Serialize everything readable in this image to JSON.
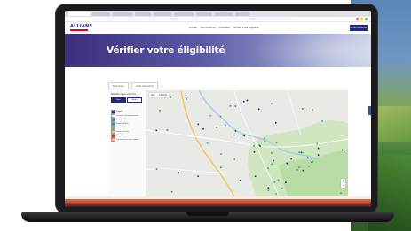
{
  "browser": {
    "tabs": [
      "",
      "",
      "",
      "",
      "",
      "",
      "",
      "",
      ""
    ],
    "active_tab": 0,
    "window_dots": [
      "#ea4335",
      "#fbbc05",
      "#34a853"
    ]
  },
  "site": {
    "logo_text": "ALLIANS",
    "nav_items": [
      "Accueil",
      "Nos solutions",
      "Actualités",
      "Vérifier votre éligibilité"
    ],
    "nav_button": "Nous contacter"
  },
  "hero": {
    "title": "Vérifier votre éligibilité"
  },
  "content": {
    "tabs": [
      "Formulaire",
      "Carte interactive"
    ],
    "panel_title": "Résultat de la recherche",
    "toggle": [
      "Fibre",
      "Radio"
    ],
    "legend": [
      {
        "label": "Éligible",
        "color": "#1e2a78"
      },
      {
        "label": "En cours de déploiement",
        "color": "#ffffff"
      },
      {
        "label": "Éligible Fibre",
        "color": "#4a8bd6"
      },
      {
        "label": "Éligible Radio",
        "color": "#27a35a"
      },
      {
        "label": "Non éligible",
        "color": "#9aa0a6"
      },
      {
        "label": "Zone couverte",
        "color": "#b6dfa0"
      },
      {
        "label": "4G / 5G",
        "color": "#d93025"
      },
      {
        "label": "Couverture réseau partiel",
        "color": "#f2c94c"
      }
    ],
    "map_controls": [
      "Plan",
      "Satellite"
    ],
    "zoom": [
      "+",
      "−"
    ]
  },
  "colors": {
    "brand": "#1e2a78",
    "hero_start": "#3a2f7a",
    "hero_end": "#c9d1e6",
    "footer_accent": "#f27a3b"
  }
}
